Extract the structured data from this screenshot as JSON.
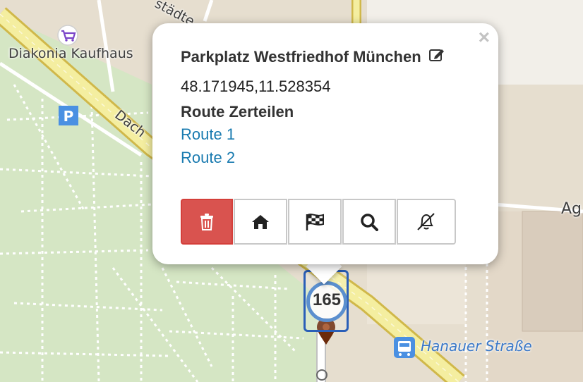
{
  "map": {
    "labels": {
      "kaufhaus": "Diakonia Kaufhaus",
      "street_diag": "Dach",
      "street_top": "städte",
      "street_right": "Ag",
      "bus_stop": "Hanauer Straße"
    },
    "icons": [
      "shopping-cart-icon",
      "parking-icon",
      "bus-stop-icon",
      "map-marker-icon"
    ],
    "cluster": {
      "count": "165"
    },
    "colors": {
      "park_green": "#d5e6c4",
      "urban_beige": "#e6decf",
      "road_yellow": "#f4eea0",
      "road_border": "#d0b84a",
      "parking_blue": "#4a90e2",
      "marker_brown": "#6b2a0b"
    }
  },
  "popup": {
    "title": "Parkplatz Westfriedhof München",
    "coordinates": "48.171945,11.528354",
    "subtitle": "Route Zerteilen",
    "routes": [
      "Route 1",
      "Route 2"
    ],
    "close_label": "×",
    "buttons": [
      "delete",
      "home",
      "checkered-flag",
      "search",
      "notifications-off"
    ],
    "colors": {
      "delete_bg": "#d9534f",
      "link": "#1a7bb0"
    }
  }
}
